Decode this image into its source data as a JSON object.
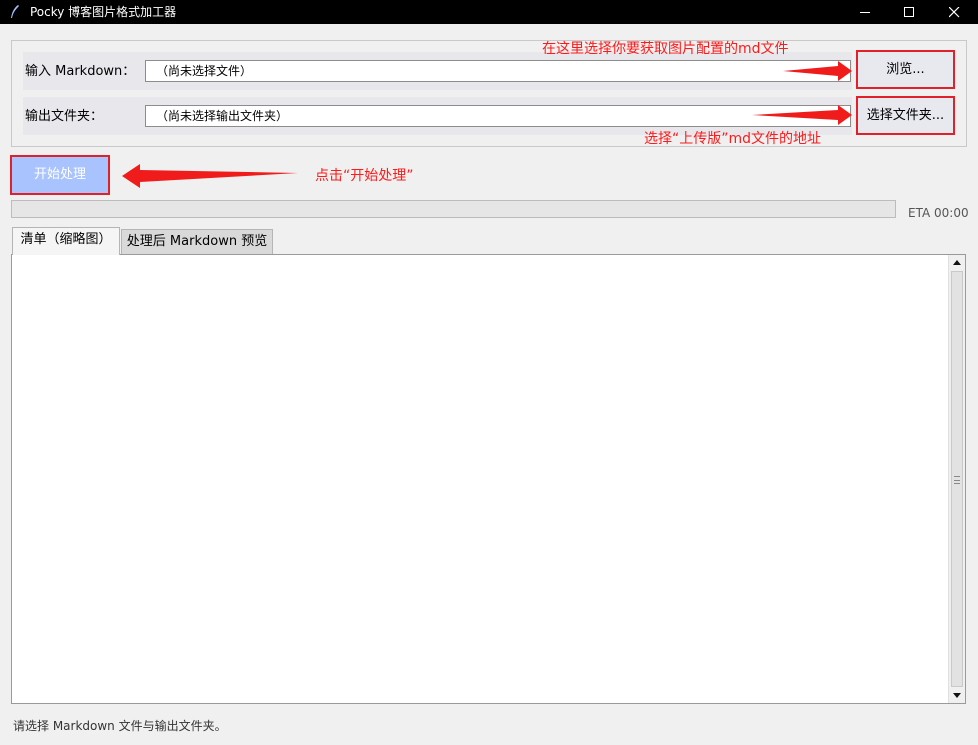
{
  "window": {
    "title": "Pocky 博客图片格式加工器",
    "app_icon": "feather-icon",
    "controls": [
      "minimize-icon",
      "maximize-icon",
      "close-icon"
    ]
  },
  "input_row": {
    "label": "输入 Markdown：",
    "path_value": "（尚未选择文件）",
    "button_label": "浏览..."
  },
  "output_row": {
    "label": "输出文件夹：",
    "path_value": "（尚未选择输出文件夹）",
    "button_label": "选择文件夹..."
  },
  "start_button_label": "开始处理",
  "progress": {
    "fraction": 0,
    "eta": "ETA 00:00"
  },
  "tabs": [
    {
      "label": "清单（缩略图）",
      "selected": true
    },
    {
      "label": "处理后 Markdown 预览",
      "selected": false
    }
  ],
  "annotations": {
    "browse_hint": "在这里选择你要获取图片配置的md文件",
    "folder_hint": "选择“上传版”md文件的地址",
    "start_hint": "点击“开始处理”",
    "color": "#ff1a1a"
  },
  "status_text": "请选择 Markdown 文件与输出文件夹。",
  "colors": {
    "highlight_border": "#e0202a",
    "start_button": "#a9c3ff",
    "titlebar": "#000000"
  }
}
